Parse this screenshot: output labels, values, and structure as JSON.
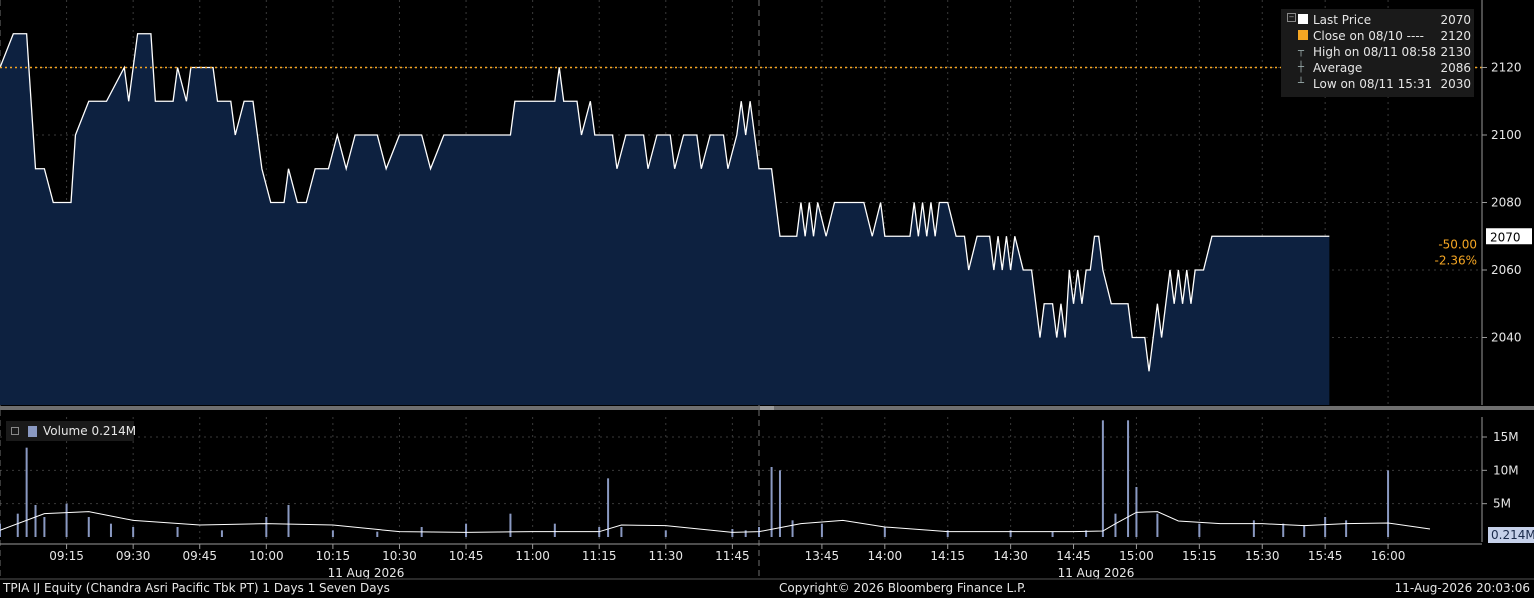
{
  "chart_data": {
    "type": "line",
    "title": "TPIA IJ Equity (Chandra Asri Pacific Tbk PT) 1 Days 1 Seven Days",
    "date_label": "11 Aug 2026",
    "x_ticks": [
      "09:15",
      "09:30",
      "09:45",
      "10:00",
      "10:15",
      "10:30",
      "10:45",
      "11:00",
      "11:15",
      "11:30",
      "11:45",
      "13:45",
      "14:00",
      "14:15",
      "14:30",
      "14:45",
      "15:00",
      "15:15",
      "15:30",
      "15:45",
      "16:00"
    ],
    "price_ticks": [
      2040,
      2060,
      2080,
      2100,
      2120
    ],
    "price_ylim": [
      2020,
      2140
    ],
    "volume_ticks": [
      "5M",
      "10M",
      "15M"
    ],
    "volume_ylim": [
      0,
      18
    ],
    "last_price": 2070,
    "last_price_label": "2070",
    "change_abs": "-50.00",
    "change_pct": "-2.36%",
    "prev_close": 2120,
    "price_series": [
      [
        "09:00",
        2120
      ],
      [
        "09:03",
        2130
      ],
      [
        "09:06",
        2130
      ],
      [
        "09:08",
        2090
      ],
      [
        "09:10",
        2090
      ],
      [
        "09:12",
        2080
      ],
      [
        "09:16",
        2080
      ],
      [
        "09:17",
        2100
      ],
      [
        "09:20",
        2110
      ],
      [
        "09:24",
        2110
      ],
      [
        "09:28",
        2120
      ],
      [
        "09:29",
        2110
      ],
      [
        "09:31",
        2130
      ],
      [
        "09:34",
        2130
      ],
      [
        "09:35",
        2110
      ],
      [
        "09:39",
        2110
      ],
      [
        "09:40",
        2120
      ],
      [
        "09:42",
        2110
      ],
      [
        "09:43",
        2120
      ],
      [
        "09:48",
        2120
      ],
      [
        "09:49",
        2110
      ],
      [
        "09:52",
        2110
      ],
      [
        "09:53",
        2100
      ],
      [
        "09:55",
        2110
      ],
      [
        "09:57",
        2110
      ],
      [
        "09:59",
        2090
      ],
      [
        "10:01",
        2080
      ],
      [
        "10:04",
        2080
      ],
      [
        "10:05",
        2090
      ],
      [
        "10:07",
        2080
      ],
      [
        "10:09",
        2080
      ],
      [
        "10:11",
        2090
      ],
      [
        "10:14",
        2090
      ],
      [
        "10:16",
        2100
      ],
      [
        "10:18",
        2090
      ],
      [
        "10:20",
        2100
      ],
      [
        "10:25",
        2100
      ],
      [
        "10:27",
        2090
      ],
      [
        "10:30",
        2100
      ],
      [
        "10:35",
        2100
      ],
      [
        "10:37",
        2090
      ],
      [
        "10:40",
        2100
      ],
      [
        "10:55",
        2100
      ],
      [
        "10:56",
        2110
      ],
      [
        "11:05",
        2110
      ],
      [
        "11:06",
        2120
      ],
      [
        "11:07",
        2110
      ],
      [
        "11:10",
        2110
      ],
      [
        "11:11",
        2100
      ],
      [
        "11:13",
        2110
      ],
      [
        "11:14",
        2100
      ],
      [
        "11:18",
        2100
      ],
      [
        "11:19",
        2090
      ],
      [
        "11:21",
        2100
      ],
      [
        "11:25",
        2100
      ],
      [
        "11:26",
        2090
      ],
      [
        "11:28",
        2100
      ],
      [
        "11:31",
        2100
      ],
      [
        "11:32",
        2090
      ],
      [
        "11:34",
        2100
      ],
      [
        "11:37",
        2100
      ],
      [
        "11:38",
        2090
      ],
      [
        "11:40",
        2100
      ],
      [
        "11:43",
        2100
      ],
      [
        "11:44",
        2090
      ],
      [
        "11:46",
        2100
      ],
      [
        "11:47",
        2110
      ],
      [
        "11:48",
        2100
      ],
      [
        "11:49",
        2110
      ],
      [
        "11:51",
        2090
      ],
      [
        "13:30",
        2090
      ],
      [
        "13:33",
        2090
      ],
      [
        "13:35",
        2070
      ],
      [
        "13:39",
        2070
      ],
      [
        "13:40",
        2080
      ],
      [
        "13:41",
        2070
      ],
      [
        "13:42",
        2080
      ],
      [
        "13:43",
        2070
      ],
      [
        "13:44",
        2080
      ],
      [
        "13:46",
        2070
      ],
      [
        "13:48",
        2080
      ],
      [
        "13:55",
        2080
      ],
      [
        "13:57",
        2070
      ],
      [
        "13:59",
        2080
      ],
      [
        "14:00",
        2070
      ],
      [
        "14:06",
        2070
      ],
      [
        "14:07",
        2080
      ],
      [
        "14:08",
        2070
      ],
      [
        "14:09",
        2080
      ],
      [
        "14:10",
        2070
      ],
      [
        "14:11",
        2080
      ],
      [
        "14:12",
        2070
      ],
      [
        "14:13",
        2080
      ],
      [
        "14:15",
        2080
      ],
      [
        "14:17",
        2070
      ],
      [
        "14:19",
        2070
      ],
      [
        "14:20",
        2060
      ],
      [
        "14:22",
        2070
      ],
      [
        "14:25",
        2070
      ],
      [
        "14:26",
        2060
      ],
      [
        "14:27",
        2070
      ],
      [
        "14:28",
        2060
      ],
      [
        "14:29",
        2070
      ],
      [
        "14:30",
        2060
      ],
      [
        "14:31",
        2070
      ],
      [
        "14:33",
        2060
      ],
      [
        "14:35",
        2060
      ],
      [
        "14:36",
        2050
      ],
      [
        "14:37",
        2040
      ],
      [
        "14:38",
        2050
      ],
      [
        "14:40",
        2050
      ],
      [
        "14:41",
        2040
      ],
      [
        "14:42",
        2050
      ],
      [
        "14:43",
        2040
      ],
      [
        "14:44",
        2060
      ],
      [
        "14:45",
        2050
      ],
      [
        "14:46",
        2060
      ],
      [
        "14:47",
        2050
      ],
      [
        "14:48",
        2060
      ],
      [
        "14:49",
        2060
      ],
      [
        "14:50",
        2070
      ],
      [
        "14:51",
        2070
      ],
      [
        "14:52",
        2060
      ],
      [
        "14:54",
        2050
      ],
      [
        "14:58",
        2050
      ],
      [
        "14:59",
        2040
      ],
      [
        "15:02",
        2040
      ],
      [
        "15:03",
        2030
      ],
      [
        "15:04",
        2040
      ],
      [
        "15:05",
        2050
      ],
      [
        "15:06",
        2040
      ],
      [
        "15:08",
        2060
      ],
      [
        "15:09",
        2050
      ],
      [
        "15:10",
        2060
      ],
      [
        "15:11",
        2050
      ],
      [
        "15:12",
        2060
      ],
      [
        "15:13",
        2050
      ],
      [
        "15:14",
        2060
      ],
      [
        "15:16",
        2060
      ],
      [
        "15:18",
        2070
      ],
      [
        "15:46",
        2070
      ]
    ],
    "volume_series": [
      [
        "09:00",
        2
      ],
      [
        "09:04",
        3.5
      ],
      [
        "09:06",
        13.4
      ],
      [
        "09:08",
        4.8
      ],
      [
        "09:10",
        3
      ],
      [
        "09:15",
        5
      ],
      [
        "09:20",
        3
      ],
      [
        "09:25",
        2
      ],
      [
        "09:30",
        1.5
      ],
      [
        "09:40",
        1.5
      ],
      [
        "09:50",
        1
      ],
      [
        "10:00",
        3
      ],
      [
        "10:05",
        4.8
      ],
      [
        "10:15",
        1
      ],
      [
        "10:25",
        0.8
      ],
      [
        "10:35",
        1.5
      ],
      [
        "10:45",
        2
      ],
      [
        "10:55",
        3.5
      ],
      [
        "11:05",
        2
      ],
      [
        "11:15",
        1.5
      ],
      [
        "11:17",
        8.8
      ],
      [
        "11:20",
        1.5
      ],
      [
        "11:30",
        1
      ],
      [
        "11:45",
        1.2
      ],
      [
        "11:48",
        1
      ],
      [
        "13:30",
        1.5
      ],
      [
        "13:33",
        10.5
      ],
      [
        "13:35",
        10
      ],
      [
        "13:38",
        2.5
      ],
      [
        "13:45",
        2
      ],
      [
        "14:00",
        1.5
      ],
      [
        "14:15",
        1
      ],
      [
        "14:30",
        1
      ],
      [
        "14:40",
        0.8
      ],
      [
        "14:48",
        1
      ],
      [
        "14:52",
        17.5
      ],
      [
        "14:55",
        3.5
      ],
      [
        "14:58",
        17.5
      ],
      [
        "15:00",
        7.5
      ],
      [
        "15:05",
        3.5
      ],
      [
        "15:15",
        2
      ],
      [
        "15:28",
        2.5
      ],
      [
        "15:35",
        2
      ],
      [
        "15:40",
        1.8
      ],
      [
        "15:45",
        3
      ],
      [
        "15:50",
        2.5
      ],
      [
        "16:00",
        10
      ]
    ],
    "volume_avg_series": [
      [
        "09:00",
        1
      ],
      [
        "09:10",
        3.5
      ],
      [
        "09:20",
        3.8
      ],
      [
        "09:30",
        2.5
      ],
      [
        "09:45",
        1.8
      ],
      [
        "10:00",
        2
      ],
      [
        "10:15",
        1.8
      ],
      [
        "10:30",
        0.8
      ],
      [
        "10:45",
        0.7
      ],
      [
        "11:00",
        0.8
      ],
      [
        "11:15",
        0.8
      ],
      [
        "11:20",
        1.8
      ],
      [
        "11:30",
        1.7
      ],
      [
        "11:45",
        0.7
      ],
      [
        "13:30",
        0.8
      ],
      [
        "13:40",
        2
      ],
      [
        "13:50",
        2.5
      ],
      [
        "14:00",
        1.5
      ],
      [
        "14:15",
        0.8
      ],
      [
        "14:30",
        0.8
      ],
      [
        "14:45",
        0.8
      ],
      [
        "14:52",
        0.9
      ],
      [
        "14:55",
        2
      ],
      [
        "15:00",
        3.7
      ],
      [
        "15:05",
        3.8
      ],
      [
        "15:10",
        2.4
      ],
      [
        "15:20",
        2
      ],
      [
        "15:30",
        2
      ],
      [
        "15:40",
        1.7
      ],
      [
        "15:50",
        2
      ],
      [
        "16:00",
        2.1
      ],
      [
        "16:10",
        1.2
      ]
    ],
    "volume_last_label": "0.214M"
  },
  "legend": {
    "items": [
      {
        "kind": "swatch",
        "color": "#ffffff",
        "label": "Last Price",
        "value": "2070"
      },
      {
        "kind": "swatch",
        "color": "#f5a623",
        "label": "Close on 08/10 ---- ",
        "value": "2120"
      },
      {
        "kind": "tree",
        "glyph": "┬",
        "label": "High on 08/11 08:58",
        "value": "2130"
      },
      {
        "kind": "tree",
        "glyph": "┼",
        "label": "Average",
        "value": "2086"
      },
      {
        "kind": "tree",
        "glyph": "┴",
        "label": "Low on 08/11 15:31",
        "value": "2030"
      }
    ]
  },
  "volume_legend": {
    "label": "Volume 0.214M"
  },
  "footer": {
    "left": "TPIA IJ Equity (Chandra Asri Pacific Tbk PT) 1 Days 1 Seven Days",
    "center": "Copyright© 2026 Bloomberg Finance L.P.",
    "right": "11-Aug-2026 20:03:06"
  },
  "colors": {
    "area_fill": "#0d2140",
    "line": "#ffffff",
    "prev_close": "#f5a623",
    "volume_bar": "#8a99c2",
    "change": "#f5a623",
    "grid": "#3a3a3a"
  }
}
